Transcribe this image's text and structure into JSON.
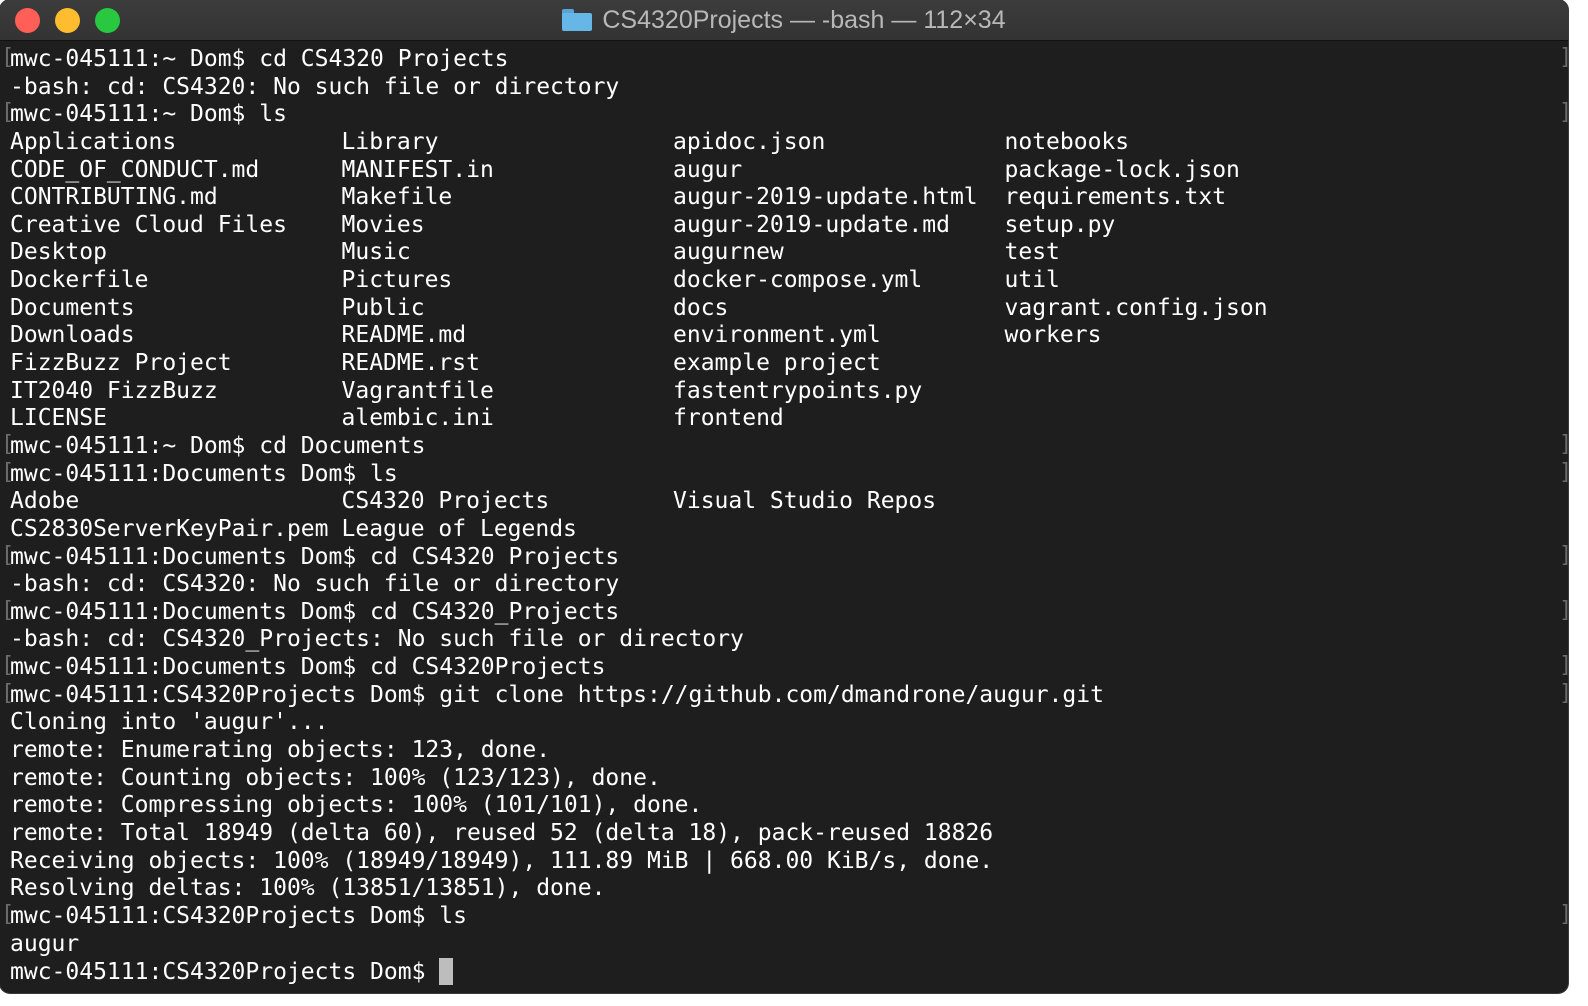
{
  "window": {
    "title": "CS4320Projects — -bash — 112×34"
  },
  "terminal": {
    "block1": [
      "mwc-045111:~ Dom$ cd CS4320 Projects",
      "-bash: cd: CS4320: No such file or directory",
      "mwc-045111:~ Dom$ ls"
    ],
    "ls_home_rows": [
      [
        "Applications",
        "Library",
        "apidoc.json",
        "notebooks"
      ],
      [
        "CODE_OF_CONDUCT.md",
        "MANIFEST.in",
        "augur",
        "package-lock.json"
      ],
      [
        "CONTRIBUTING.md",
        "Makefile",
        "augur-2019-update.html",
        "requirements.txt"
      ],
      [
        "Creative Cloud Files",
        "Movies",
        "augur-2019-update.md",
        "setup.py"
      ],
      [
        "Desktop",
        "Music",
        "augurnew",
        "test"
      ],
      [
        "Dockerfile",
        "Pictures",
        "docker-compose.yml",
        "util"
      ],
      [
        "Documents",
        "Public",
        "docs",
        "vagrant.config.json"
      ],
      [
        "Downloads",
        "README.md",
        "environment.yml",
        "workers"
      ],
      [
        "FizzBuzz Project",
        "README.rst",
        "example project",
        ""
      ],
      [
        "IT2040 FizzBuzz",
        "Vagrantfile",
        "fastentrypoints.py",
        ""
      ],
      [
        "LICENSE",
        "alembic.ini",
        "frontend",
        ""
      ]
    ],
    "block2": [
      "mwc-045111:~ Dom$ cd Documents",
      "mwc-045111:Documents Dom$ ls"
    ],
    "ls_documents_rows": [
      [
        "Adobe",
        "CS4320 Projects",
        "Visual Studio Repos",
        ""
      ],
      [
        "CS2830ServerKeyPair.pem",
        "League of Legends",
        "",
        ""
      ]
    ],
    "block3": [
      "mwc-045111:Documents Dom$ cd CS4320 Projects",
      "-bash: cd: CS4320: No such file or directory",
      "mwc-045111:Documents Dom$ cd CS4320_Projects",
      "-bash: cd: CS4320_Projects: No such file or directory",
      "mwc-045111:Documents Dom$ cd CS4320Projects",
      "mwc-045111:CS4320Projects Dom$ git clone https://github.com/dmandrone/augur.git",
      "Cloning into 'augur'...",
      "remote: Enumerating objects: 123, done.",
      "remote: Counting objects: 100% (123/123), done.",
      "remote: Compressing objects: 100% (101/101), done.",
      "remote: Total 18949 (delta 60), reused 52 (delta 18), pack-reused 18826",
      "Receiving objects: 100% (18949/18949), 111.89 MiB | 668.00 KiB/s, done.",
      "Resolving deltas: 100% (13851/13851), done.",
      "mwc-045111:CS4320Projects Dom$ ls",
      "augur"
    ],
    "current_prompt": "mwc-045111:CS4320Projects Dom$ "
  }
}
